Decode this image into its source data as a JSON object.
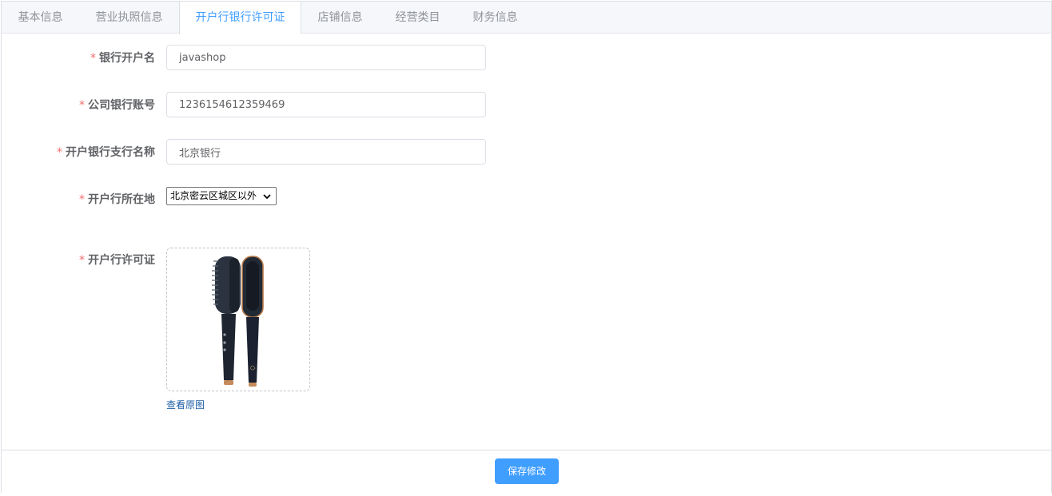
{
  "tabs": [
    {
      "label": "基本信息",
      "active": false
    },
    {
      "label": "营业执照信息",
      "active": false
    },
    {
      "label": "开户行银行许可证",
      "active": true
    },
    {
      "label": "店铺信息",
      "active": false
    },
    {
      "label": "经营类目",
      "active": false
    },
    {
      "label": "财务信息",
      "active": false
    }
  ],
  "form": {
    "required_mark": "*",
    "account_name": {
      "label": "银行开户名",
      "value": "javashop"
    },
    "account_number": {
      "label": "公司银行账号",
      "value": "1236154612359469"
    },
    "branch_name": {
      "label": "开户银行支行名称",
      "value": "北京银行"
    },
    "location": {
      "label": "开户行所在地",
      "selected": "北京密云区城区以外"
    },
    "license": {
      "label": "开户行许可证",
      "view_link": "查看原图",
      "image_icon": "hair-straightener-brush-image"
    }
  },
  "footer": {
    "save_label": "保存修改"
  },
  "colors": {
    "accent": "#409eff",
    "required": "#f56c6c",
    "link": "#1f5fa6"
  }
}
